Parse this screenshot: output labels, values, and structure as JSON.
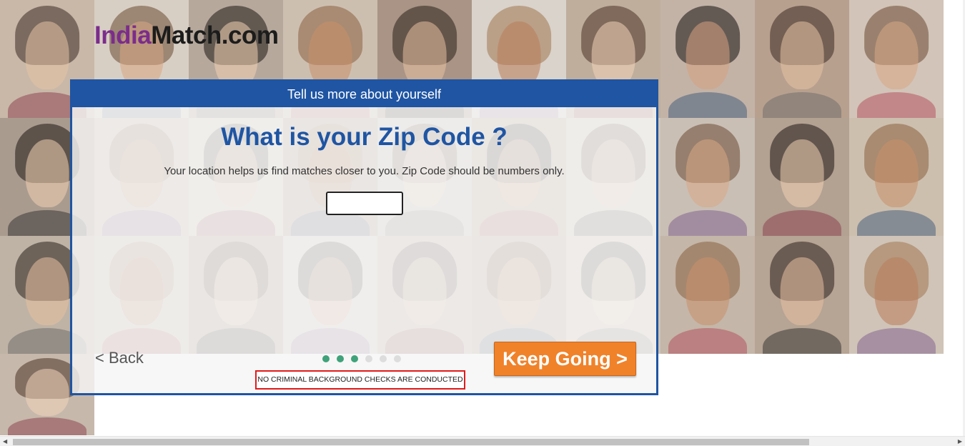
{
  "logo": {
    "part1": "India",
    "part2": "Match.com"
  },
  "modal": {
    "header": "Tell us more about yourself",
    "title": "What is your Zip Code ?",
    "help_text": "Your location helps us find matches closer to you. Zip Code should be numbers only.",
    "zip_value": "",
    "back_label": "< Back",
    "continue_label": "Keep Going >",
    "notice": "NO CRIMINAL BACKGROUND CHECKS ARE CONDUCTED",
    "progress": {
      "total_steps": 6,
      "completed_steps": 3
    }
  },
  "colors": {
    "accent_blue": "#1f55a3",
    "brand_purple": "#7b2c8c",
    "button_orange": "#f0822a",
    "progress_green": "#3fa27a",
    "notice_red": "#e21a1a"
  },
  "icons": {
    "scroll_left": "arrow-left-icon",
    "scroll_right": "arrow-right-icon"
  }
}
